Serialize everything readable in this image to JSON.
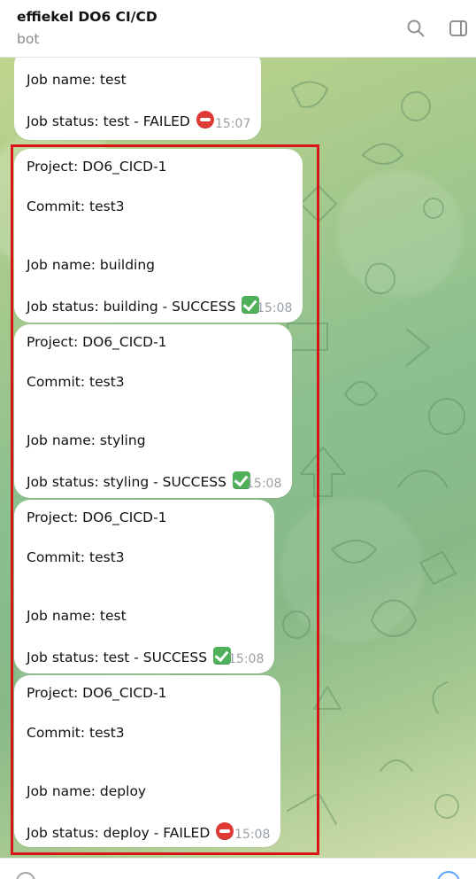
{
  "header": {
    "chat_title": "effiekel DO6 CI/CD",
    "chat_subtitle": "bot",
    "icons": {
      "search": "search-icon",
      "side_panel": "side-panel-icon"
    }
  },
  "messages": {
    "items": [
      {
        "job_name": "Job name: test",
        "job_status": "Job status: test - FAILED",
        "status_icon": "no-entry-icon",
        "time": "15:07"
      },
      {
        "project": "Project: DO6_CICD-1",
        "commit": "Commit: test3",
        "job_name": "Job name: building",
        "job_status": "Job status: building - SUCCESS",
        "status_icon": "check-mark-button-icon",
        "time": "15:08"
      },
      {
        "project": "Project: DO6_CICD-1",
        "commit": "Commit: test3",
        "job_name": "Job name: styling",
        "job_status": "Job status: styling - SUCCESS",
        "status_icon": "check-mark-button-icon",
        "time": "15:08"
      },
      {
        "project": "Project: DO6_CICD-1",
        "commit": "Commit: test3",
        "job_name": "Job name: test",
        "job_status": "Job status: test - SUCCESS",
        "status_icon": "check-mark-button-icon",
        "time": "15:08"
      },
      {
        "project": "Project: DO6_CICD-1",
        "commit": "Commit: test3",
        "job_name": "Job name: deploy",
        "job_status": "Job status: deploy - FAILED",
        "status_icon": "no-entry-icon",
        "time": "15:08"
      }
    ]
  },
  "colors": {
    "selection_outline": "#d91416",
    "success": "#4fb05a",
    "failed": "#df3a35",
    "timestamp": "#9aa1a6",
    "accent": "#5aa6ff"
  }
}
